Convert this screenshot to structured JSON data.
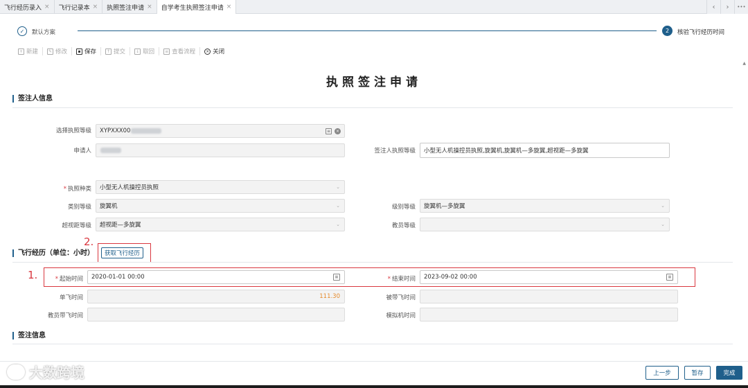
{
  "tabs": [
    {
      "label": "飞行经历录入",
      "active": false
    },
    {
      "label": "飞行记录本",
      "active": false
    },
    {
      "label": "执照签注申请",
      "active": false
    },
    {
      "label": "自学考生执照签注申请",
      "active": true
    }
  ],
  "tab_nav": {
    "prev": "‹",
    "next": "›",
    "more": "•••"
  },
  "steps": {
    "step1_num": "✓",
    "step1_label": "默认方案",
    "step2_num": "2",
    "step2_label": "核验飞行经历时间"
  },
  "toolbar": [
    {
      "label": "新建",
      "enabled": false
    },
    {
      "label": "修改",
      "enabled": false
    },
    {
      "label": "保存",
      "enabled": true
    },
    {
      "label": "提交",
      "enabled": false
    },
    {
      "label": "取回",
      "enabled": false
    },
    {
      "label": "查看流程",
      "enabled": false
    },
    {
      "label": "关闭",
      "enabled": true
    }
  ],
  "page_title": "执照签注申请",
  "sections": {
    "applicant": "签注人信息",
    "flight": "飞行经历（单位：小时）",
    "endorse": "签注信息"
  },
  "applicant": {
    "license_level_label": "选择执照等级",
    "license_level_value": "XYPXXX00",
    "applicant_label": "申请人",
    "endorser_level_label": "签注人执照等级",
    "endorser_level_value": "小型无人机操控员执照,旋翼机,旋翼机—多旋翼,超视距—多旋翼",
    "license_type_label": "执照种类",
    "license_type_value": "小型无人机操控员执照",
    "category_label": "类别等级",
    "category_value": "旋翼机",
    "class_label": "级别等级",
    "class_value": "旋翼机—多旋翼",
    "bvlos_label": "超视距等级",
    "bvlos_value": "超视距—多旋翼",
    "instructor_label": "教员等级",
    "instructor_value": ""
  },
  "flight": {
    "get_button": "获取飞行经历",
    "start_label": "起始时间",
    "start_value": "2020-01-01  00:00",
    "end_label": "结束时间",
    "end_value": "2023-09-02  00:00",
    "solo_label": "单飞时间",
    "solo_value": "111.30",
    "dual_label": "被带飞时间",
    "dual_value": "",
    "instructor_label": "教员带飞时间",
    "instructor_value": "",
    "sim_label": "模拟机时间",
    "sim_value": ""
  },
  "annotations": {
    "one": "1.",
    "two": "2."
  },
  "footer": {
    "prev": "上一步",
    "save": "暂存",
    "done": "完成"
  },
  "watermark": "大数跨境",
  "colors": {
    "accent": "#1f5f8b",
    "annotation_red": "#d9363e",
    "value_orange": "#e58a2b"
  }
}
